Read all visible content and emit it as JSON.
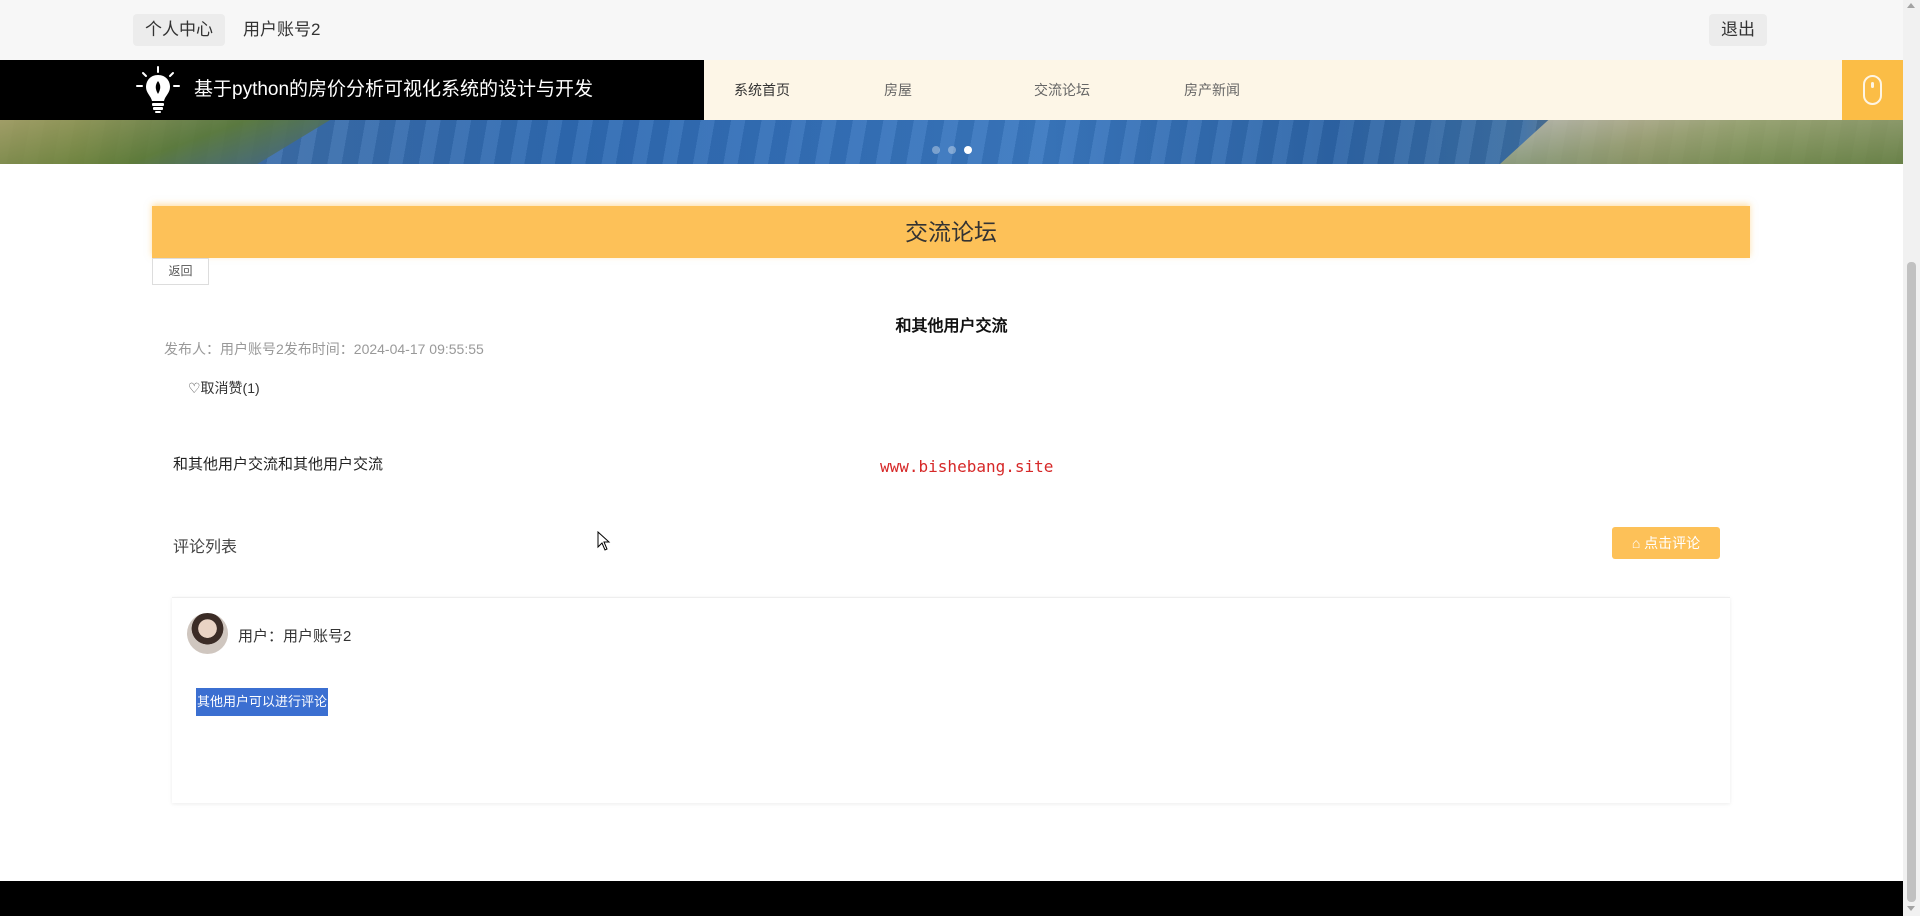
{
  "topbar": {
    "personal_center": "个人中心",
    "account": "用户账号2",
    "logout": "退出"
  },
  "header": {
    "logo_icon": "lightbulb-icon",
    "title": "基于python的房价分析可视化系统的设计与开发",
    "nav": [
      "系统首页",
      "房屋",
      "交流论坛",
      "房产新闻"
    ],
    "active_nav": "系统首页",
    "cta_icon": "mouse-icon"
  },
  "banner": {
    "slide_count": 3,
    "active_slide": 3
  },
  "forum": {
    "section_title": "交流论坛",
    "back_label": "返回",
    "post_title": "和其他用户交流",
    "meta": "发布人：用户账号2发布时间：2024-04-17 09:55:55",
    "like_label": "♡取消赞(1)",
    "content": "和其他用户交流和其他用户交流",
    "watermark": "www.bishebang.site",
    "comments_label": "评论列表",
    "comment_button": "点击评论",
    "comment_button_icon": "home-icon"
  },
  "comments": [
    {
      "user_label": "用户：用户账号2",
      "text": "其他用户可以进行评论"
    }
  ],
  "colors": {
    "accent": "#fdc158",
    "nav_bg": "#fdf6e7",
    "brand_bg": "#000000",
    "selection": "#3b6fd1",
    "watermark": "#d62828"
  }
}
